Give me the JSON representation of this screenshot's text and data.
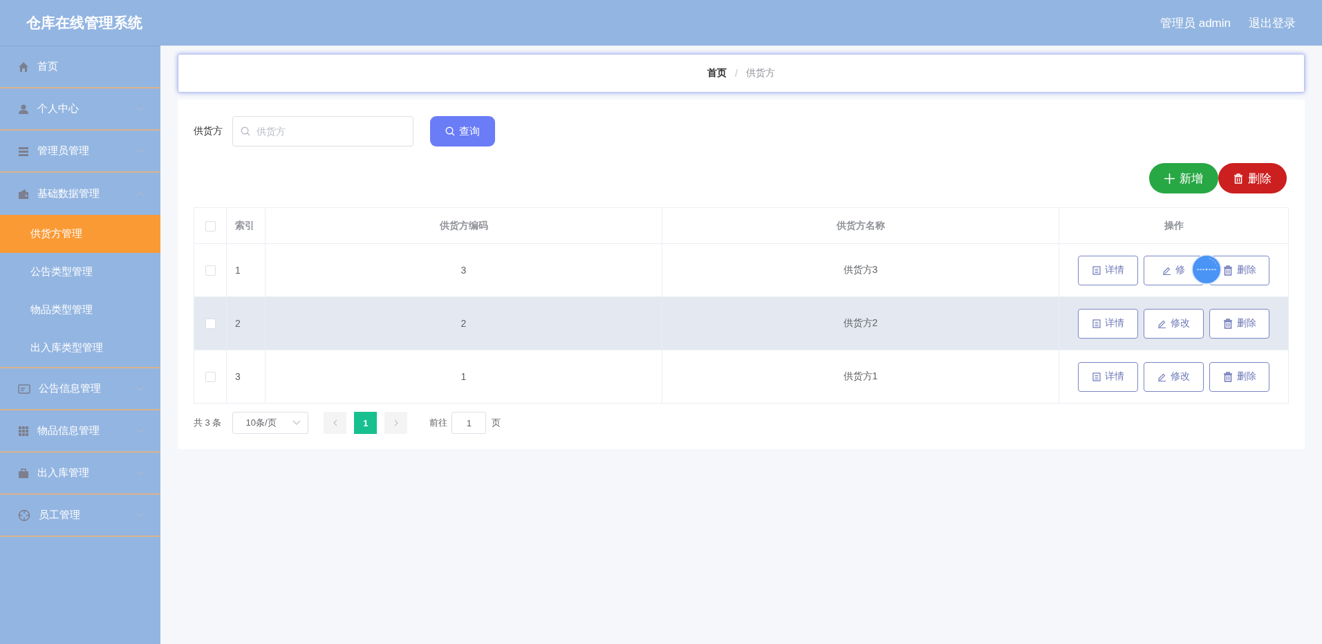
{
  "header": {
    "title": "仓库在线管理系统",
    "user": "管理员 admin",
    "logout": "退出登录"
  },
  "sidebar": {
    "items": [
      {
        "label": "首页",
        "kind": "link"
      },
      {
        "label": "个人中心",
        "kind": "menu",
        "expanded": false
      },
      {
        "label": "管理员管理",
        "kind": "menu",
        "expanded": false
      },
      {
        "label": "基础数据管理",
        "kind": "menu",
        "expanded": true,
        "children": [
          {
            "label": "供货方管理",
            "selected": true
          },
          {
            "label": "公告类型管理",
            "selected": false
          },
          {
            "label": "物品类型管理",
            "selected": false
          },
          {
            "label": "出入库类型管理",
            "selected": false
          }
        ]
      },
      {
        "label": "公告信息管理",
        "kind": "menu",
        "expanded": false
      },
      {
        "label": "物品信息管理",
        "kind": "menu",
        "expanded": false
      },
      {
        "label": "出入库管理",
        "kind": "menu",
        "expanded": false
      },
      {
        "label": "员工管理",
        "kind": "menu",
        "expanded": false
      }
    ]
  },
  "breadcrumb": {
    "separator": "/",
    "items": [
      {
        "label": "首页",
        "current": false
      },
      {
        "label": "供货方",
        "current": true
      }
    ]
  },
  "search": {
    "label": "供货方",
    "placeholder": "供货方",
    "button": "查询"
  },
  "toolbar": {
    "add": "新增",
    "delete": "删除"
  },
  "table": {
    "header_checked": false,
    "columns": [
      "索引",
      "供货方编码",
      "供货方名称",
      "操作"
    ],
    "rows": [
      {
        "checked": false,
        "hovered": false,
        "index": "1",
        "code": "3",
        "name": "供货方3",
        "actions": [
          {
            "kind": "detail",
            "label": "详情"
          },
          {
            "kind": "edit",
            "label": "修"
          },
          {
            "kind": "delete",
            "label": "删除"
          }
        ]
      },
      {
        "checked": false,
        "hovered": true,
        "index": "2",
        "code": "2",
        "name": "供货方2",
        "actions": [
          {
            "kind": "detail",
            "label": "详情"
          },
          {
            "kind": "edit",
            "label": "修改"
          },
          {
            "kind": "delete",
            "label": "删除"
          }
        ]
      },
      {
        "checked": false,
        "hovered": false,
        "index": "3",
        "code": "1",
        "name": "供货方1",
        "actions": [
          {
            "kind": "detail",
            "label": "详情"
          },
          {
            "kind": "edit",
            "label": "修改"
          },
          {
            "kind": "delete",
            "label": "删除"
          }
        ]
      }
    ]
  },
  "pagination": {
    "total": "共 3 条",
    "page_size": "10条/页",
    "pages": [
      {
        "label": "1",
        "selected": true
      }
    ],
    "goto_label": "前往",
    "goto_value": "1",
    "goto_suffix": "页"
  }
}
